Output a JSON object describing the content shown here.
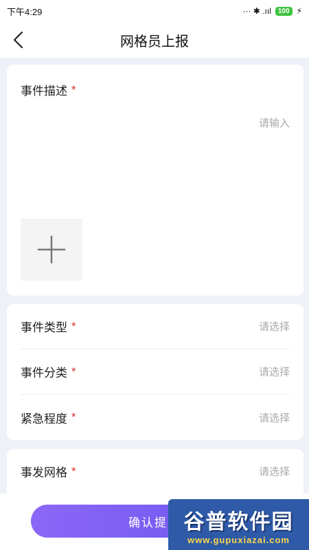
{
  "status_bar": {
    "time": "下午4:29",
    "indicators": "··· ✱ .ııl",
    "battery": "100"
  },
  "nav": {
    "title": "网格员上报"
  },
  "description_card": {
    "label": "事件描述",
    "required": "*",
    "placeholder": "请输入"
  },
  "type_card": {
    "rows": [
      {
        "label": "事件类型",
        "required": "*",
        "value": "请选择"
      },
      {
        "label": "事件分类",
        "required": "*",
        "value": "请选择"
      },
      {
        "label": "紧急程度",
        "required": "*",
        "value": "请选择"
      }
    ]
  },
  "grid_card": {
    "rows": [
      {
        "label": "事发网格",
        "required": "*",
        "value": "请选择"
      }
    ]
  },
  "submit": {
    "label": "确认提交"
  },
  "watermark": {
    "main": "谷普软件园",
    "sub": "www.gupuxiazai.com"
  },
  "colors": {
    "accent_start": "#8b67f7",
    "accent_end": "#6a55ef",
    "required": "#e03131"
  }
}
